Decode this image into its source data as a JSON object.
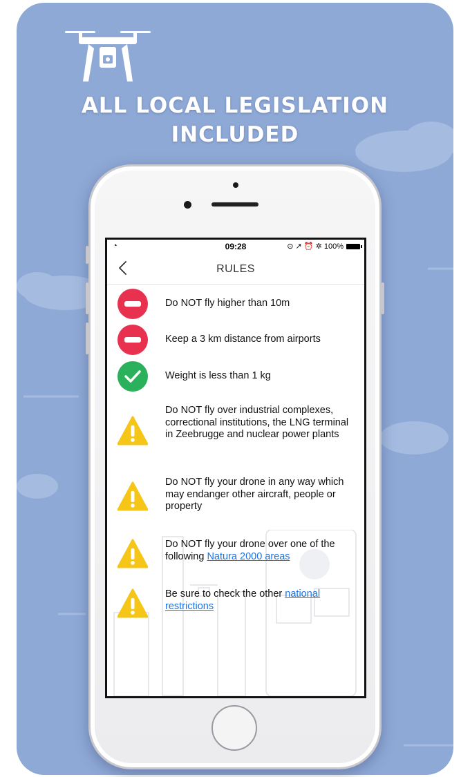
{
  "headline": {
    "line1": "ALL LOCAL LEGISLATION",
    "line2": "INCLUDED"
  },
  "status_bar": {
    "time": "09:28",
    "wifi": "wifi-icon",
    "right_icons": "⊙ ↗ ⏰ ✲",
    "battery_text": "100%"
  },
  "nav": {
    "title": "RULES",
    "back_icon": "chevron-left-icon"
  },
  "colors": {
    "background": "#8fa9d7",
    "forbidden": "#e8304f",
    "allowed": "#2bb05b",
    "warning": "#f5c518",
    "link": "#1a73e8"
  },
  "rules": [
    {
      "status": "forbidden",
      "icon": "no-entry-icon",
      "text": "Do NOT fly higher than 10m"
    },
    {
      "status": "forbidden",
      "icon": "no-entry-icon",
      "text": "Keep a 3 km distance from airports"
    },
    {
      "status": "allowed",
      "icon": "checkmark-icon",
      "text": "Weight is less than 1 kg"
    },
    {
      "status": "warning",
      "icon": "warning-icon",
      "text": "Do NOT fly over industrial complexes, correctional institutions, the LNG terminal in Zeebrugge and nuclear power plants"
    },
    {
      "status": "warning",
      "icon": "warning-icon",
      "text": "Do NOT fly your drone in any way which may endanger other aircraft, people or property"
    },
    {
      "status": "warning",
      "icon": "warning-icon",
      "text_before": "Do NOT fly your drone over one of the following ",
      "link": "Natura 2000 areas"
    },
    {
      "status": "warning",
      "icon": "warning-icon",
      "text_before": "Be sure to check the other ",
      "link": "national restrictions"
    }
  ]
}
